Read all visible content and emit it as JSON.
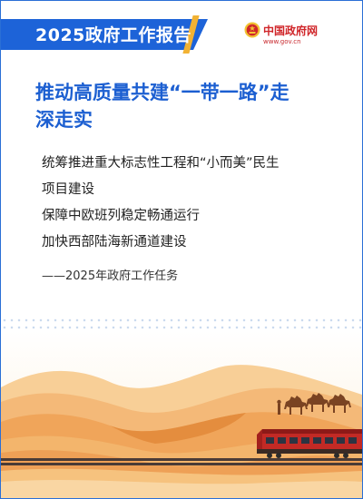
{
  "badge": {
    "year": "2025",
    "label": "政府工作报告"
  },
  "source": {
    "name": "中国政府网",
    "url": "www.gov.cn"
  },
  "headline": {
    "line1": "推动高质量共建“一带一路”走",
    "line2": "深走实"
  },
  "points": [
    "统筹推进重大标志性工程和“小而美”民生",
    "项目建设",
    "保障中欧班列稳定畅通运行",
    "加快西部陆海新通道建设"
  ],
  "signature": "——2025年政府工作任务",
  "colors": {
    "brand_blue": "#1d63d8",
    "headline_blue": "#1c5fd1",
    "gov_red": "#d0262a",
    "sand": "#f0a859",
    "sky": "#fdf2e4"
  },
  "icons": {
    "emblem": "national-emblem-icon",
    "illustration": "desert-train-camels"
  }
}
